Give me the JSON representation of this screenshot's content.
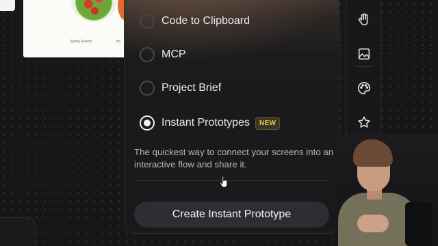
{
  "canvas_card": {
    "caption_1": "Spring Greens",
    "caption_2": "Bo"
  },
  "export_panel": {
    "options": [
      {
        "label": "Code to Clipboard",
        "selected": false
      },
      {
        "label": "MCP",
        "selected": false
      },
      {
        "label": "Project Brief",
        "selected": false
      },
      {
        "label": "Instant Prototypes",
        "selected": true,
        "badge": "NEW"
      }
    ],
    "description": "The quickest way to connect your screens into an interactive flow and share it.",
    "cta_label": "Create Instant Prototype"
  },
  "toolbar": {
    "tools": [
      "hand-icon",
      "image-icon",
      "palette-icon",
      "star-icon"
    ]
  },
  "colors": {
    "badge_text": "#e0c65a",
    "panel_bg": "#19191b",
    "canvas_bg": "#17171a"
  }
}
